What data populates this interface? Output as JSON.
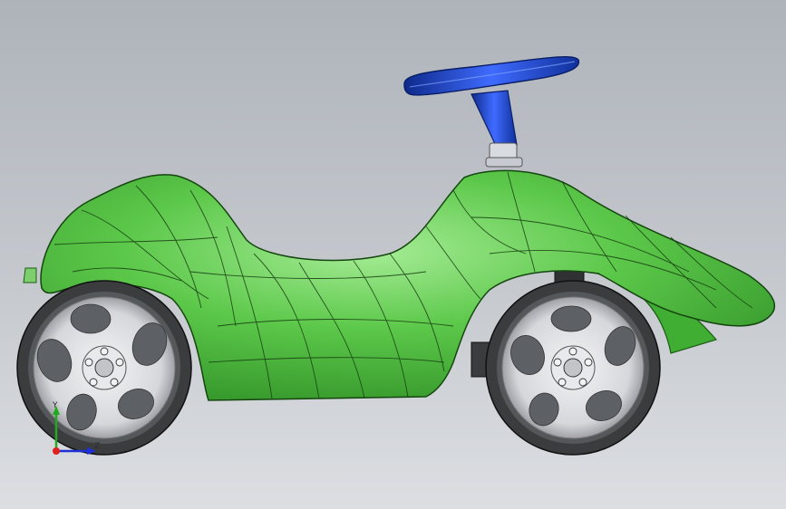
{
  "viewport": {
    "background_top": "#aeb3ba",
    "background_bottom": "#dcdee2"
  },
  "model": {
    "body_color": "#46b83a",
    "body_highlight": "#8fe07f",
    "steering_color": "#1f47c4",
    "wheel_rim_color": "#dcdde0",
    "tire_color": "#3a3c3e"
  },
  "triad": {
    "y_label": "Y",
    "z_label": "Z",
    "y_color": "#1faa1f",
    "z_color": "#1d2fd6",
    "origin_color": "#e0201b"
  }
}
